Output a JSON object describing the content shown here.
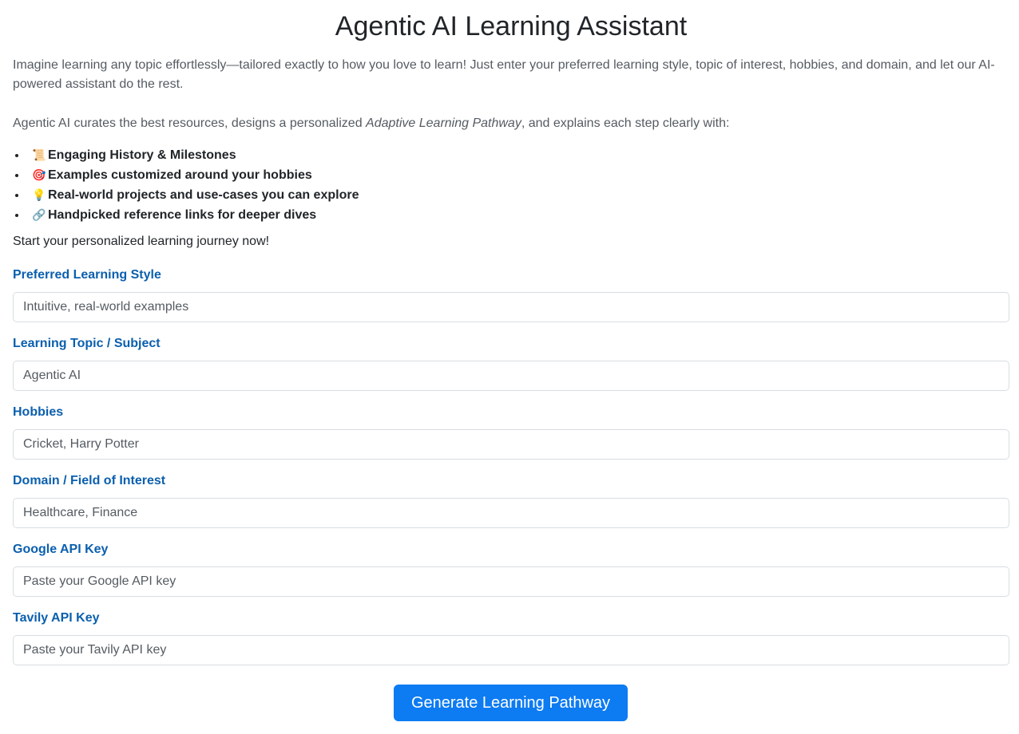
{
  "header": {
    "title": "Agentic AI Learning Assistant"
  },
  "intro": {
    "paragraph1": "Imagine learning any topic effortlessly—tailored exactly to how you love to learn! Just enter your preferred learning style, topic of interest, hobbies, and domain, and let our AI-powered assistant do the rest.",
    "paragraph2_before": "Agentic AI curates the best resources, designs a personalized ",
    "paragraph2_emphasis": "Adaptive Learning Pathway",
    "paragraph2_after": ", and explains each step clearly with:",
    "features": [
      {
        "emoji": "📜",
        "icon": "scroll-icon",
        "text": "Engaging History & Milestones"
      },
      {
        "emoji": "🎯",
        "icon": "target-icon",
        "text": "Examples customized around your hobbies"
      },
      {
        "emoji": "💡",
        "icon": "lightbulb-icon",
        "text": "Real-world projects and use-cases you can explore"
      },
      {
        "emoji": "🔗",
        "icon": "link-icon",
        "text": "Handpicked reference links for deeper dives"
      }
    ],
    "cta": "Start your personalized learning journey now!"
  },
  "form": {
    "learning_style": {
      "label": "Preferred Learning Style",
      "placeholder": "Intuitive, real-world examples"
    },
    "topic": {
      "label": "Learning Topic / Subject",
      "placeholder": "Agentic AI"
    },
    "hobbies": {
      "label": "Hobbies",
      "placeholder": "Cricket, Harry Potter"
    },
    "domain": {
      "label": "Domain / Field of Interest",
      "placeholder": "Healthcare, Finance"
    },
    "google_key": {
      "label": "Google API Key",
      "placeholder": "Paste your Google API key"
    },
    "tavily_key": {
      "label": "Tavily API Key",
      "placeholder": "Paste your Tavily API key"
    },
    "submit_label": "Generate Learning Pathway"
  },
  "colors": {
    "accent": "#0d7bf2",
    "label": "#0b5fae"
  }
}
